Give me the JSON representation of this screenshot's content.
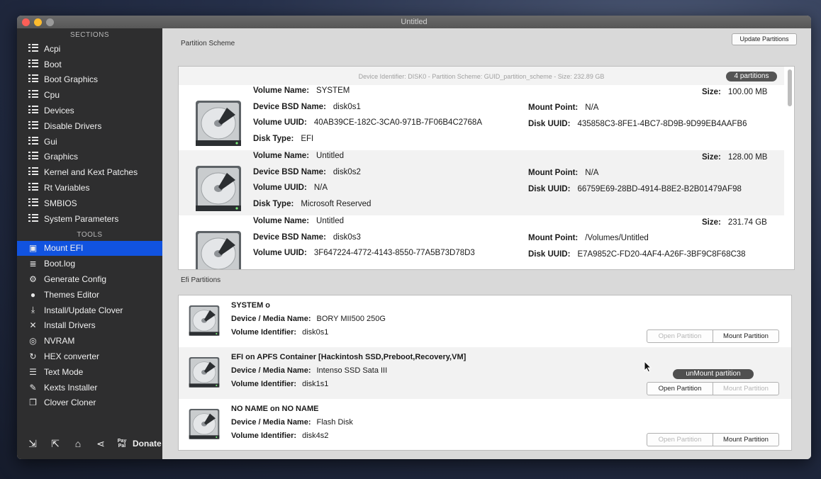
{
  "window": {
    "title": "Untitled"
  },
  "sidebar": {
    "sections_label": "SECTIONS",
    "sections": [
      {
        "label": "Acpi",
        "icon": "list-icon"
      },
      {
        "label": "Boot",
        "icon": "list-icon"
      },
      {
        "label": "Boot Graphics",
        "icon": "list-icon"
      },
      {
        "label": "Cpu",
        "icon": "list-icon"
      },
      {
        "label": "Devices",
        "icon": "list-icon"
      },
      {
        "label": "Disable Drivers",
        "icon": "list-icon"
      },
      {
        "label": "Gui",
        "icon": "list-icon"
      },
      {
        "label": "Graphics",
        "icon": "list-icon"
      },
      {
        "label": "Kernel and Kext Patches",
        "icon": "list-icon"
      },
      {
        "label": "Rt Variables",
        "icon": "list-icon"
      },
      {
        "label": "SMBIOS",
        "icon": "list-icon"
      },
      {
        "label": "System Parameters",
        "icon": "list-icon"
      }
    ],
    "tools_label": "TOOLS",
    "tools": [
      {
        "label": "Mount EFI",
        "icon": "mount-efi-icon",
        "glyph": "▣",
        "active": true
      },
      {
        "label": "Boot.log",
        "icon": "boot-log-icon",
        "glyph": "≣",
        "active": false
      },
      {
        "label": "Generate Config",
        "icon": "gears-icon",
        "glyph": "⚙",
        "active": false
      },
      {
        "label": "Themes Editor",
        "icon": "palette-icon",
        "glyph": "●",
        "active": false
      },
      {
        "label": "Install/Update Clover",
        "icon": "download-icon",
        "glyph": "⤓",
        "active": false
      },
      {
        "label": "Install Drivers",
        "icon": "tools-icon",
        "glyph": "✕",
        "active": false
      },
      {
        "label": "NVRAM",
        "icon": "nvram-icon",
        "glyph": "◎",
        "active": false
      },
      {
        "label": "HEX converter",
        "icon": "hex-converter-icon",
        "glyph": "↻",
        "active": false
      },
      {
        "label": "Text Mode",
        "icon": "text-mode-icon",
        "glyph": "☰",
        "active": false
      },
      {
        "label": "Kexts Installer",
        "icon": "kexts-installer-icon",
        "glyph": "✎",
        "active": false
      },
      {
        "label": "Clover Cloner",
        "icon": "clone-icon",
        "glyph": "❐",
        "active": false
      }
    ],
    "bottom": {
      "paypal_text": "Pay Pal",
      "donate_label": "Donate"
    }
  },
  "toolbar": {
    "update_partitions_label": "Update Partitions"
  },
  "partition_scheme": {
    "group_label": "Partition Scheme",
    "header": "Device Identifier: DISK0 - Partition Scheme: GUID_partition_scheme - Size: 232.89 GB",
    "count_badge": "4 partitions",
    "field_labels": {
      "volume_name": "Volume Name:",
      "bsd_name": "Device BSD Name:",
      "volume_uuid": "Volume UUID:",
      "disk_type": "Disk Type:",
      "size": "Size:",
      "mount_point": "Mount Point:",
      "disk_uuid": "Disk UUID:"
    },
    "partitions": [
      {
        "volume_name": "SYSTEM",
        "bsd_name": "disk0s1",
        "volume_uuid": "40AB39CE-182C-3CA0-971B-7F06B4C2768A",
        "disk_type": "EFI",
        "size": "100.00 MB",
        "mount_point": "N/A",
        "disk_uuid": "435858C3-8FE1-4BC7-8D9B-9D99EB4AAFB6"
      },
      {
        "volume_name": "Untitled",
        "bsd_name": "disk0s2",
        "volume_uuid": "N/A",
        "disk_type": "Microsoft Reserved",
        "size": "128.00 MB",
        "mount_point": "N/A",
        "disk_uuid": "66759E69-28BD-4914-B8E2-B2B01479AF98"
      },
      {
        "volume_name": "Untitled",
        "bsd_name": "disk0s3",
        "volume_uuid": "3F647224-4772-4143-8550-77A5B73D78D3",
        "disk_type": "",
        "size": "231.74 GB",
        "mount_point": "/Volumes/Untitled",
        "disk_uuid": "E7A9852C-FD20-4AF4-A26F-3BF9C8F68C38"
      }
    ]
  },
  "efi_partitions": {
    "group_label": "Efi Partitions",
    "field_labels": {
      "media_name": "Device / Media Name:",
      "volume_identifier": "Volume Identifier:"
    },
    "open_label": "Open Partition",
    "mount_label": "Mount Partition",
    "unmount_label": "unMount partition",
    "items": [
      {
        "title": "SYSTEM o",
        "media_name": "BORY MII500 250G",
        "volume_identifier": "disk0s1",
        "mounted": false
      },
      {
        "title": "EFI on APFS Container [Hackintosh SSD,Preboot,Recovery,VM]",
        "media_name": "Intenso SSD Sata III",
        "volume_identifier": "disk1s1",
        "mounted": true
      },
      {
        "title": "NO NAME on NO NAME",
        "media_name": "Flash Disk",
        "volume_identifier": "disk4s2",
        "mounted": false
      }
    ]
  }
}
